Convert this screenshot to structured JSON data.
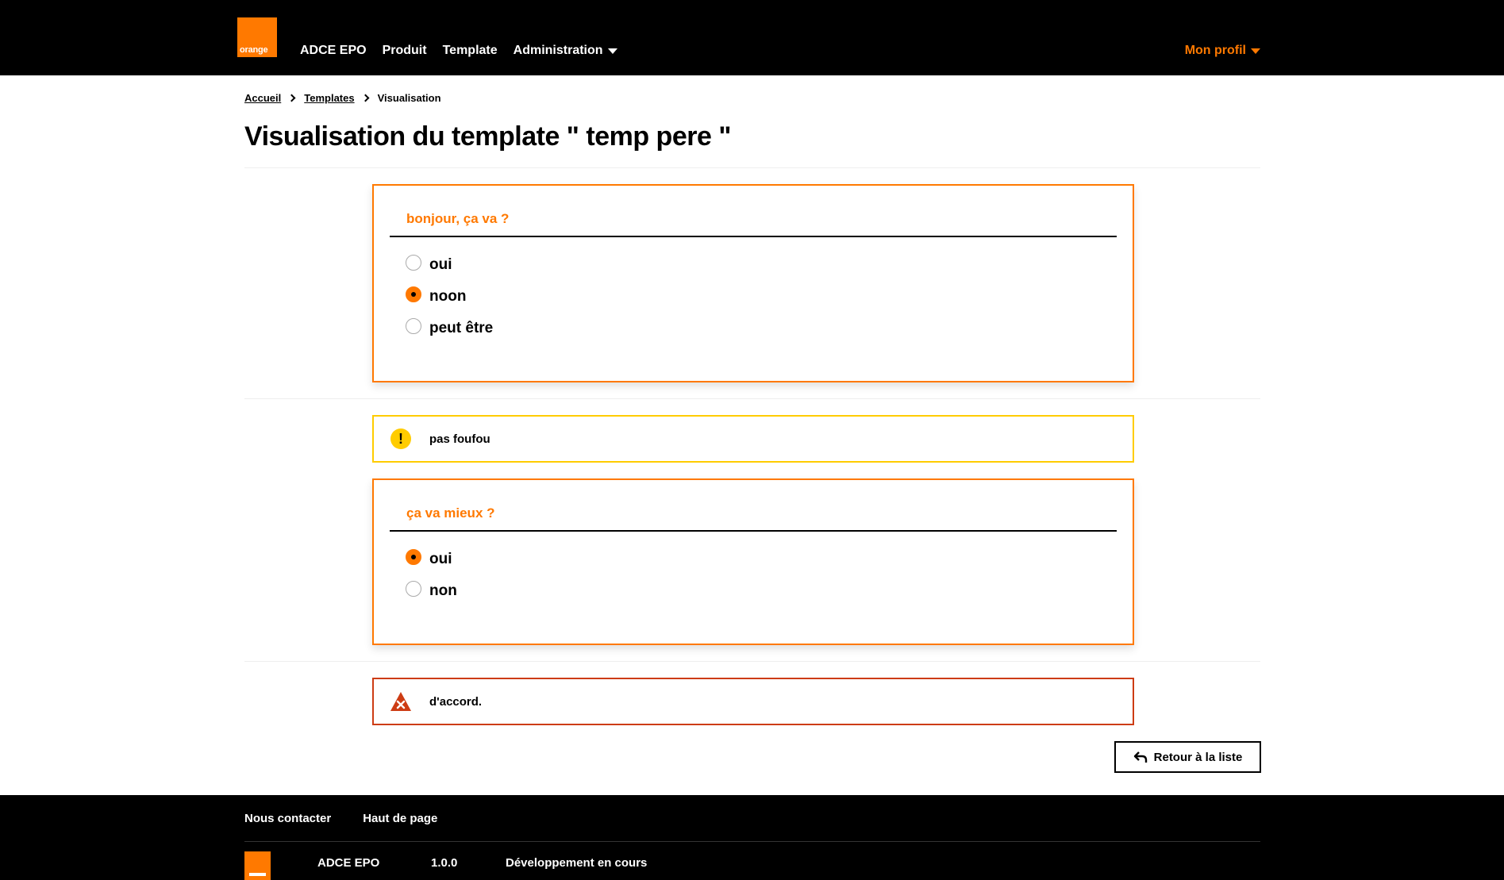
{
  "header": {
    "logo_text": "orange",
    "nav": [
      "ADCE EPO",
      "Produit",
      "Template",
      "Administration"
    ],
    "profile": "Mon profil"
  },
  "breadcrumb": [
    "Accueil",
    "Templates",
    "Visualisation"
  ],
  "page_title": "Visualisation du template \" temp pere \"",
  "questions": [
    {
      "title": "bonjour, ça va ?",
      "options": [
        {
          "label": "oui",
          "checked": false
        },
        {
          "label": "noon",
          "checked": true
        },
        {
          "label": "peut être",
          "checked": false
        }
      ]
    },
    {
      "title": "ça va mieux ?",
      "options": [
        {
          "label": "oui",
          "checked": true
        },
        {
          "label": "non",
          "checked": false
        }
      ]
    }
  ],
  "alerts": {
    "warning": "pas foufou",
    "error": "d'accord."
  },
  "back_button": "Retour à la liste",
  "footer": {
    "links": [
      "Nous contacter",
      "Haut de page"
    ],
    "app_name": "ADCE EPO",
    "version": "1.0.0",
    "status": "Développement en cours"
  },
  "colors": {
    "brand": "#ff7900",
    "warning": "#ffcc00",
    "error": "#cd3c14"
  }
}
